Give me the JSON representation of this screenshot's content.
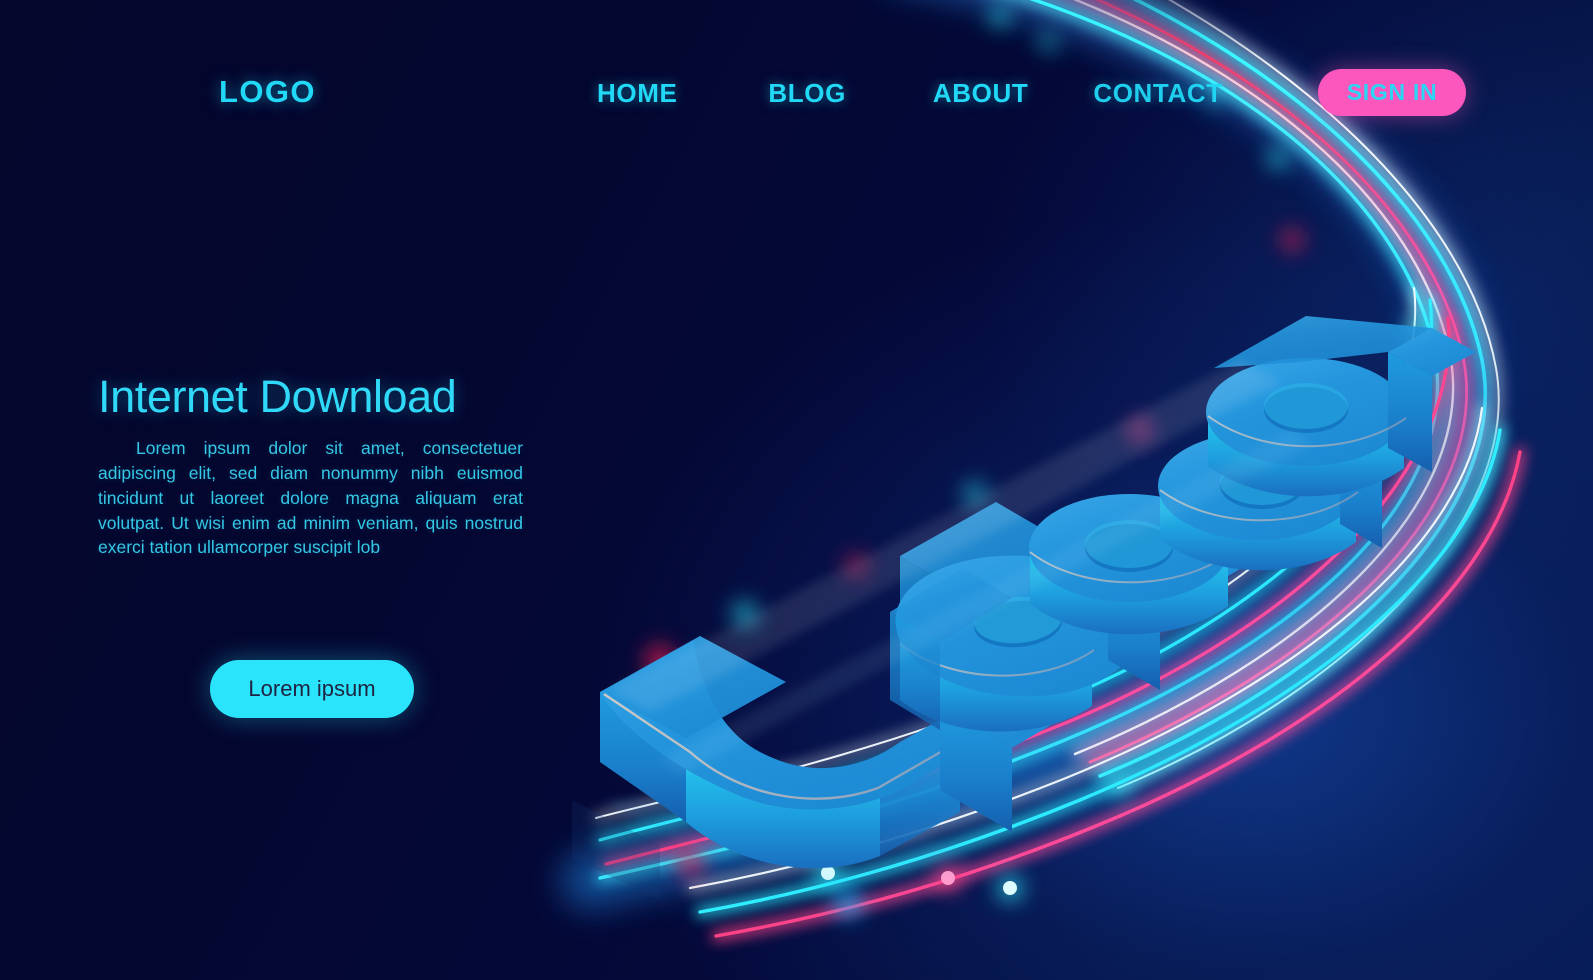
{
  "meta": {
    "accent_cyan": "#21d9f7",
    "accent_pink": "#fb57bd",
    "accent_red": "#f31d4e",
    "bg_navy": "#04062c",
    "letter_blue": "#1f9ade"
  },
  "header": {
    "logo": "LOGO",
    "nav": [
      {
        "label": "HOME"
      },
      {
        "label": "BLOG"
      },
      {
        "label": "ABOUT"
      },
      {
        "label": "CONTACT"
      }
    ],
    "signin_label": "SIGN IN"
  },
  "hero": {
    "title": "Internet Download",
    "body": "Lorem ipsum dolor sit amet, consectetuer adipiscing elit, sed diam nonummy nibh euismod tincidunt ut laoreet dolore magna aliquam erat volutpat. Ut wisi enim ad minim veniam, quis nostrud exerci tation ullamcorper suscipit lob",
    "cta_label": "Lorem ipsum"
  },
  "artwork": {
    "word": "Upload",
    "style": "isometric-3d-extruded-lettering",
    "letters": [
      "U",
      "p",
      "l",
      "o",
      "a",
      "d"
    ]
  }
}
